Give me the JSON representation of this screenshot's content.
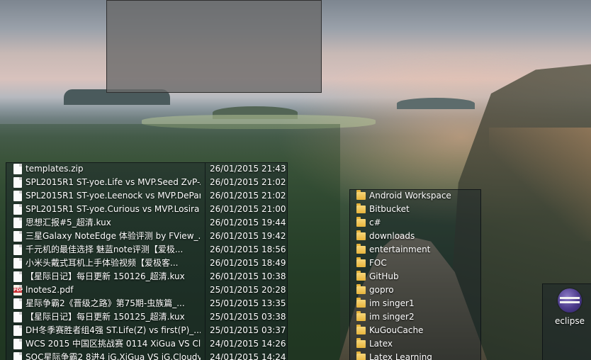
{
  "desktop": {
    "files": [
      {
        "name": "templates.zip",
        "date": "26/01/2015 21:43",
        "icon": "document-icon"
      },
      {
        "name": "SPL2015R1 ST-yoe.Life vs MVP.Seed ZvP-AC...",
        "date": "26/01/2015 21:02",
        "icon": "document-icon"
      },
      {
        "name": "SPL2015R1 ST-yoe.Leenock vs MVP.DePartu...",
        "date": "26/01/2015 21:02",
        "icon": "document-icon"
      },
      {
        "name": "SPL2015R1 ST-yoe.Curious vs MVP.Losira Zv...",
        "date": "26/01/2015 21:00",
        "icon": "document-icon"
      },
      {
        "name": "思想汇报#5_超清.kux",
        "date": "26/01/2015 19:44",
        "icon": "document-icon"
      },
      {
        "name": "三星Galaxy NoteEdge 体验评测 by FView_...",
        "date": "26/01/2015 19:42",
        "icon": "document-icon"
      },
      {
        "name": "千元机的最佳选择 魅蓝note评测【爱极...",
        "date": "26/01/2015 18:56",
        "icon": "document-icon"
      },
      {
        "name": "小米头戴式耳机上手体验视频【爱极客...",
        "date": "26/01/2015 18:49",
        "icon": "document-icon"
      },
      {
        "name": "【星际日记】每日更新 150126_超清.kux",
        "date": "26/01/2015 10:38",
        "icon": "document-icon"
      },
      {
        "name": "lnotes2.pdf",
        "date": "25/01/2015 20:28",
        "icon": "pdf-icon"
      },
      {
        "name": "星际争霸2《晋级之路》第75期-虫族篇_...",
        "date": "25/01/2015 13:35",
        "icon": "document-icon"
      },
      {
        "name": "【星际日记】每日更新 150125_超清.kux",
        "date": "25/01/2015 03:38",
        "icon": "document-icon"
      },
      {
        "name": "DH冬季赛胜者组4强 ST.Life(Z) vs first(P)_...",
        "date": "25/01/2015 03:37",
        "icon": "document-icon"
      },
      {
        "name": "WCS 2015 中国区挑战赛 0114 XiGua VS Cla...",
        "date": "24/01/2015 14:26",
        "icon": "document-icon"
      },
      {
        "name": "SOC星际争霸2 8进4 iG.XiGua VS iG.Cloudy ...",
        "date": "24/01/2015 14:24",
        "icon": "document-icon"
      }
    ],
    "folders": [
      {
        "name": "Android Workspace"
      },
      {
        "name": "Bitbucket"
      },
      {
        "name": "c#"
      },
      {
        "name": "downloads"
      },
      {
        "name": "entertainment"
      },
      {
        "name": "FOC"
      },
      {
        "name": "GitHub"
      },
      {
        "name": "gopro"
      },
      {
        "name": "im singer1"
      },
      {
        "name": "im singer2"
      },
      {
        "name": "KuGouCache"
      },
      {
        "name": "Latex"
      },
      {
        "name": "Latex Learning"
      }
    ],
    "apps": [
      {
        "name": "eclipse",
        "icon": "eclipse-icon"
      }
    ]
  },
  "colors": {
    "fence_background": "#16202680",
    "overlay_gray": "#696969",
    "folder_yellow": "#f0c24f",
    "pdf_red": "#c9282d"
  }
}
